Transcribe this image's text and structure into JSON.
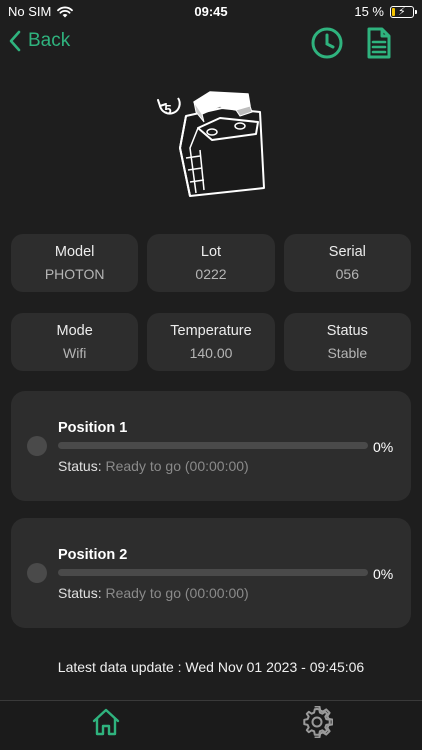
{
  "status_bar": {
    "carrier": "No SIM",
    "time": "09:45",
    "battery_percent": "15 %",
    "battery_level": 0.15
  },
  "nav": {
    "back_label": "Back",
    "icons": [
      "clock-icon",
      "document-icon"
    ]
  },
  "device": {
    "badge_number": "5"
  },
  "info_cards": [
    {
      "label": "Model",
      "value": "PHOTON"
    },
    {
      "label": "Lot",
      "value": "0222"
    },
    {
      "label": "Serial",
      "value": "056"
    },
    {
      "label": "Mode",
      "value": "Wifi"
    },
    {
      "label": "Temperature",
      "value": "140.00"
    },
    {
      "label": "Status",
      "value": "Stable"
    }
  ],
  "positions": [
    {
      "title": "Position 1",
      "progress_percent": 0,
      "progress_label": "0%",
      "status_label": "Status:",
      "status_value": "Ready to go (00:00:00)"
    },
    {
      "title": "Position 2",
      "progress_percent": 0,
      "progress_label": "0%",
      "status_label": "Status:",
      "status_value": "Ready to go (00:00:00)"
    }
  ],
  "latest_update": "Latest data update : Wed Nov 01 2023 - 09:45:06",
  "tab_bar": {
    "tabs": [
      "home-icon",
      "settings-gear-icon"
    ],
    "active": "home-icon"
  },
  "colors": {
    "accent": "#2fb37e",
    "background": "#1e1e1e",
    "card": "#2d2d2d"
  }
}
